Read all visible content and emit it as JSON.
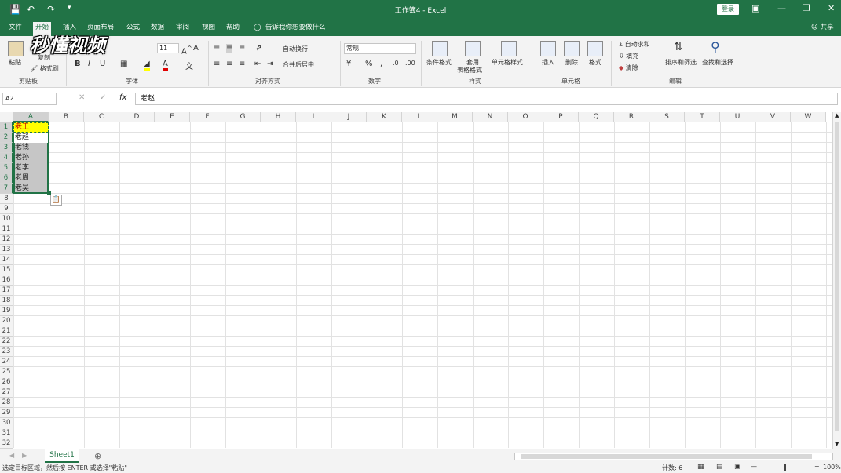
{
  "titlebar": {
    "title": "工作簿4 - Excel",
    "login": "登录"
  },
  "tabs": [
    "文件",
    "开始",
    "插入",
    "页面布局",
    "公式",
    "数据",
    "审阅",
    "视图",
    "帮助"
  ],
  "tell_me": "告诉我你想要做什么",
  "share": "共享",
  "ribbon": {
    "paste": "粘贴",
    "copy": "复制",
    "format_painter": "格式刷",
    "font_size": "11",
    "wrap_text": "自动换行",
    "merge_center": "合并后居中",
    "number_format": "常规",
    "cond_format": "条件格式",
    "table_format_1": "套用",
    "table_format_2": "表格格式",
    "cell_styles": "单元格样式",
    "insert": "插入",
    "delete": "删除",
    "format": "格式",
    "autosum": "自动求和",
    "fill": "填充",
    "clear": "清除",
    "sort_filter": "排序和筛选",
    "find_select": "查找和选择",
    "groups": [
      "剪贴板",
      "字体",
      "对齐方式",
      "数字",
      "样式",
      "单元格",
      "编辑"
    ]
  },
  "formula_bar": {
    "name_box": "A2",
    "value": "老赵"
  },
  "columns": [
    "A",
    "B",
    "C",
    "D",
    "E",
    "F",
    "G",
    "H",
    "I",
    "J",
    "K",
    "L",
    "M",
    "N",
    "O",
    "P",
    "Q",
    "R",
    "S",
    "T",
    "U",
    "V",
    "W"
  ],
  "rows": [
    "1",
    "2",
    "3",
    "4",
    "5",
    "6",
    "7",
    "8",
    "9",
    "10",
    "11",
    "12",
    "13",
    "14",
    "15",
    "16",
    "17",
    "18",
    "19",
    "20",
    "21",
    "22",
    "23",
    "24",
    "25",
    "26",
    "27",
    "28",
    "29",
    "30",
    "31",
    "32"
  ],
  "cells_A": [
    "老王",
    "老赵",
    "老钱",
    "老孙",
    "老李",
    "老周",
    "老吴"
  ],
  "sheet_tab": "Sheet1",
  "status": {
    "message": "选定目标区域，然后按 ENTER 或选择\"粘贴\"",
    "count": "计数: 6",
    "zoom": "100%"
  },
  "watermark": "秒懂视频",
  "colors": {
    "excel_green": "#217346",
    "selection": "#c6c6c6",
    "highlight": "#ffff00"
  }
}
